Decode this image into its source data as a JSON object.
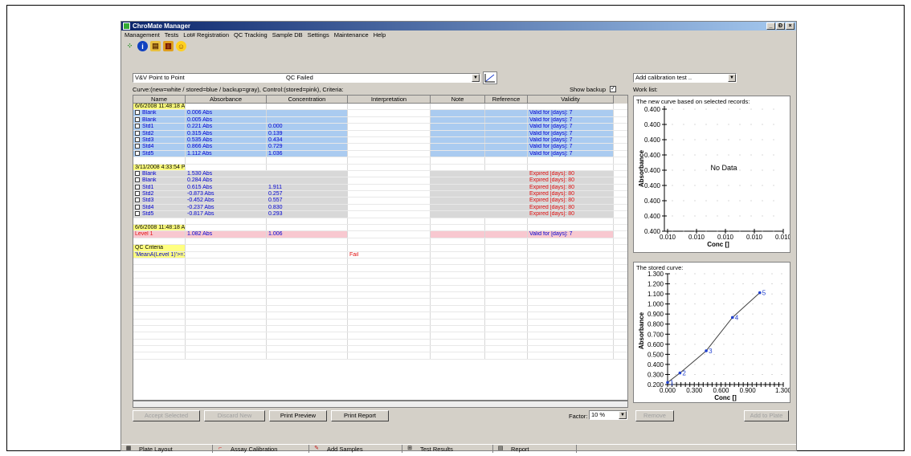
{
  "window": {
    "title": "ChroMate Manager",
    "min": "_",
    "max": "Ɖ",
    "close": "×"
  },
  "menu": [
    "Management",
    "Tests",
    "Lot# Registration",
    "QC Tracking",
    "Sample DB",
    "Settings",
    "Maintenance",
    "Help"
  ],
  "method_select": {
    "value": "V&V Point to Point"
  },
  "qc_status": "QC Failed",
  "curve_legend": "Curve:(new=white / stored=blue / backup=gray), Control:(stored=pink), Criteria:",
  "show_backup_label": "Show backup",
  "calibration_select": {
    "value": "Add calibration test .."
  },
  "worklist_label": "Work list:",
  "columns": [
    "Name",
    "Absorbance",
    "Concentration",
    "Interpretation",
    "Note",
    "Reference",
    "Validity"
  ],
  "rows": [
    {
      "type": "hdr",
      "name": "6/6/2008 11:48:18 AM"
    },
    {
      "type": "blue",
      "name": "Blank",
      "abs": "0.006  Abs",
      "conc": "",
      "val": "Valid for [days]: 7"
    },
    {
      "type": "blue",
      "name": "Blank",
      "abs": "0.005  Abs",
      "conc": "",
      "val": "Valid for [days]: 7"
    },
    {
      "type": "blue",
      "name": "Std1",
      "abs": "0.221  Abs",
      "conc": "0.000",
      "val": "Valid for [days]: 7"
    },
    {
      "type": "blue",
      "name": "Std2",
      "abs": "0.315  Abs",
      "conc": "0.139",
      "val": "Valid for [days]: 7"
    },
    {
      "type": "blue",
      "name": "Std3",
      "abs": "0.535  Abs",
      "conc": "0.434",
      "val": "Valid for [days]: 7"
    },
    {
      "type": "blue",
      "name": "Std4",
      "abs": "0.866  Abs",
      "conc": "0.729",
      "val": "Valid for [days]: 7"
    },
    {
      "type": "blue",
      "name": "Std5",
      "abs": "1.112  Abs",
      "conc": "1.036",
      "val": "Valid for [days]: 7"
    },
    {
      "type": "empty"
    },
    {
      "type": "hdr",
      "name": "3/11/2008 4:33:54 PM"
    },
    {
      "type": "gray",
      "name": "Blank",
      "abs": "1.530  Abs",
      "conc": "",
      "val": "Expired [days]: 80"
    },
    {
      "type": "gray",
      "name": "Blank",
      "abs": "0.284  Abs",
      "conc": "",
      "val": "Expired [days]: 80"
    },
    {
      "type": "gray",
      "name": "Std1",
      "abs": "0.615  Abs",
      "conc": "1.911",
      "val": "Expired [days]: 80"
    },
    {
      "type": "gray",
      "name": "Std2",
      "abs": "-0.873  Abs",
      "conc": "0.257",
      "val": "Expired [days]: 80"
    },
    {
      "type": "gray",
      "name": "Std3",
      "abs": "-0.452  Abs",
      "conc": "0.557",
      "val": "Expired [days]: 80"
    },
    {
      "type": "gray",
      "name": "Std4",
      "abs": "-0.237  Abs",
      "conc": "0.830",
      "val": "Expired [days]: 80"
    },
    {
      "type": "gray",
      "name": "Std5",
      "abs": "-0.817  Abs",
      "conc": "0.293",
      "val": "Expired [days]: 80"
    },
    {
      "type": "empty"
    },
    {
      "type": "hdr",
      "name": "6/6/2008 11:48:18 AM"
    },
    {
      "type": "pink",
      "name": "Level 1",
      "abs": "1.082  Abs",
      "conc": "1.006",
      "val": "Valid for [days]: 7"
    },
    {
      "type": "empty"
    },
    {
      "type": "hdr",
      "name": "QC Criteria"
    },
    {
      "type": "crit",
      "name": "'MeanA(Level 1)'>=1.179",
      "interp": "Fail"
    }
  ],
  "buttons": {
    "accept": "Accept Selected",
    "discard": "Discard New",
    "preview": "Print Preview",
    "report": "Print Report",
    "remove": "Remove",
    "add_to_plate": "Add to Plate"
  },
  "factor": {
    "label": "Factor:",
    "value": "10 %"
  },
  "new_curve": {
    "title": "The new curve based on selected records:",
    "no_data": "No Data",
    "ylabel": "Absorbance",
    "xlabel": "Conc []",
    "yticks": [
      "0.400",
      "0.400",
      "0.400",
      "0.400",
      "0.400",
      "0.400",
      "0.400",
      "0.400",
      "0.400"
    ],
    "xticks": [
      "0.010",
      "0.010",
      "0.010",
      "0.010",
      "0.010"
    ]
  },
  "stored_curve": {
    "title": "The stored curve:"
  },
  "chart_data": [
    {
      "type": "scatter",
      "title": "The new curve based on selected records:",
      "xlabel": "Conc []",
      "ylabel": "Absorbance",
      "annotation": "No Data",
      "x": [],
      "y": []
    },
    {
      "type": "line",
      "title": "The stored curve:",
      "xlabel": "Conc []",
      "ylabel": "Absorbance",
      "xlim": [
        0,
        1.3
      ],
      "ylim": [
        0.2,
        1.3
      ],
      "xticks": [
        "0.000",
        "0.300",
        "0.600",
        "0.900",
        "1.300"
      ],
      "yticks": [
        "1.300",
        "1.200",
        "1.100",
        "1.000",
        "0.900",
        "0.800",
        "0.700",
        "0.600",
        "0.500",
        "0.400",
        "0.300",
        "0.200"
      ],
      "x": [
        0.0,
        0.139,
        0.434,
        0.729,
        1.036
      ],
      "y": [
        0.221,
        0.315,
        0.535,
        0.866,
        1.112
      ],
      "labels": [
        "1",
        "2",
        "3",
        "4",
        "5"
      ],
      "color": "#2040d0"
    }
  ],
  "tabs": [
    "Plate Layout",
    "Assay Calibration",
    "Add Samples",
    "Test Results",
    "Report"
  ]
}
